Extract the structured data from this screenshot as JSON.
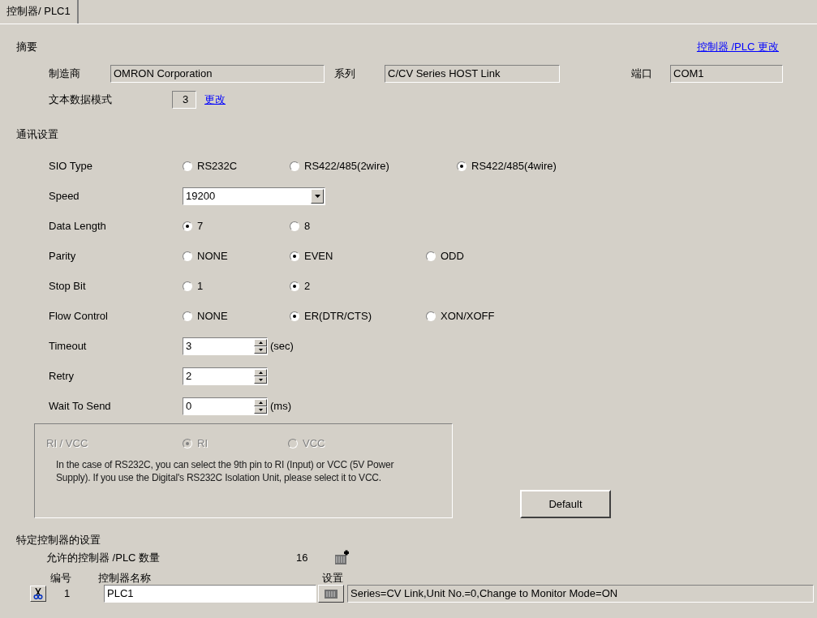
{
  "tab": {
    "label": "控制器/ PLC1",
    "selected": true
  },
  "summary": {
    "title": "摘要",
    "change_link": "控制器 /PLC 更改",
    "manufacturer_label": "制造商",
    "manufacturer": "OMRON Corporation",
    "series_label": "系列",
    "series": "C/CV Series HOST Link",
    "port_label": "端口",
    "port": "COM1",
    "text_mode_label": "文本数据模式",
    "text_mode": "3",
    "text_mode_link": "更改"
  },
  "comm": {
    "title": "通讯设置",
    "rows": [
      {
        "kind": "radio",
        "label": "SIO Type",
        "options": [
          {
            "label": "RS232C",
            "selected": false
          },
          {
            "label": "RS422/485(2wire)",
            "selected": false
          },
          {
            "label": "RS422/485(4wire)",
            "selected": true
          }
        ]
      },
      {
        "kind": "select",
        "label": "Speed",
        "value": "19200"
      },
      {
        "kind": "radio",
        "label": "Data Length",
        "options": [
          {
            "label": "7",
            "selected": true
          },
          {
            "label": "8",
            "selected": false
          }
        ]
      },
      {
        "kind": "radio",
        "label": "Parity",
        "options": [
          {
            "label": "NONE",
            "selected": false
          },
          {
            "label": "EVEN",
            "selected": true
          },
          {
            "label": "ODD",
            "selected": false
          }
        ]
      },
      {
        "kind": "radio",
        "label": "Stop Bit",
        "options": [
          {
            "label": "1",
            "selected": false
          },
          {
            "label": "2",
            "selected": true
          }
        ]
      },
      {
        "kind": "radio",
        "label": "Flow Control",
        "options": [
          {
            "label": "NONE",
            "selected": false
          },
          {
            "label": "ER(DTR/CTS)",
            "selected": true
          },
          {
            "label": "XON/XOFF",
            "selected": false
          }
        ]
      },
      {
        "kind": "spin",
        "label": "Timeout",
        "value": "3",
        "unit": "(sec)"
      },
      {
        "kind": "spin",
        "label": "Retry",
        "value": "2"
      },
      {
        "kind": "spin",
        "label": "Wait To Send",
        "value": "0",
        "unit": "(ms)"
      }
    ]
  },
  "ri_vcc": {
    "label": "RI / VCC",
    "disabled": true,
    "options": [
      {
        "label": "RI",
        "selected": true
      },
      {
        "label": "VCC",
        "selected": false
      }
    ],
    "note": "In the case of RS232C, you can select the 9th pin to RI (Input) or VCC (5V Power Supply). If you use the Digital's RS232C Isolation Unit, please select it to VCC."
  },
  "default_button": "Default",
  "device": {
    "title": "特定控制器的设置",
    "count_label": "允许的控制器 /PLC 数量",
    "count": "16",
    "columns": [
      "编号",
      "控制器名称",
      "设置"
    ],
    "rows": [
      {
        "number": "1",
        "name": "PLC1",
        "settings": "Series=CV Link,Unit No.=0,Change to Monitor Mode=ON"
      }
    ]
  }
}
